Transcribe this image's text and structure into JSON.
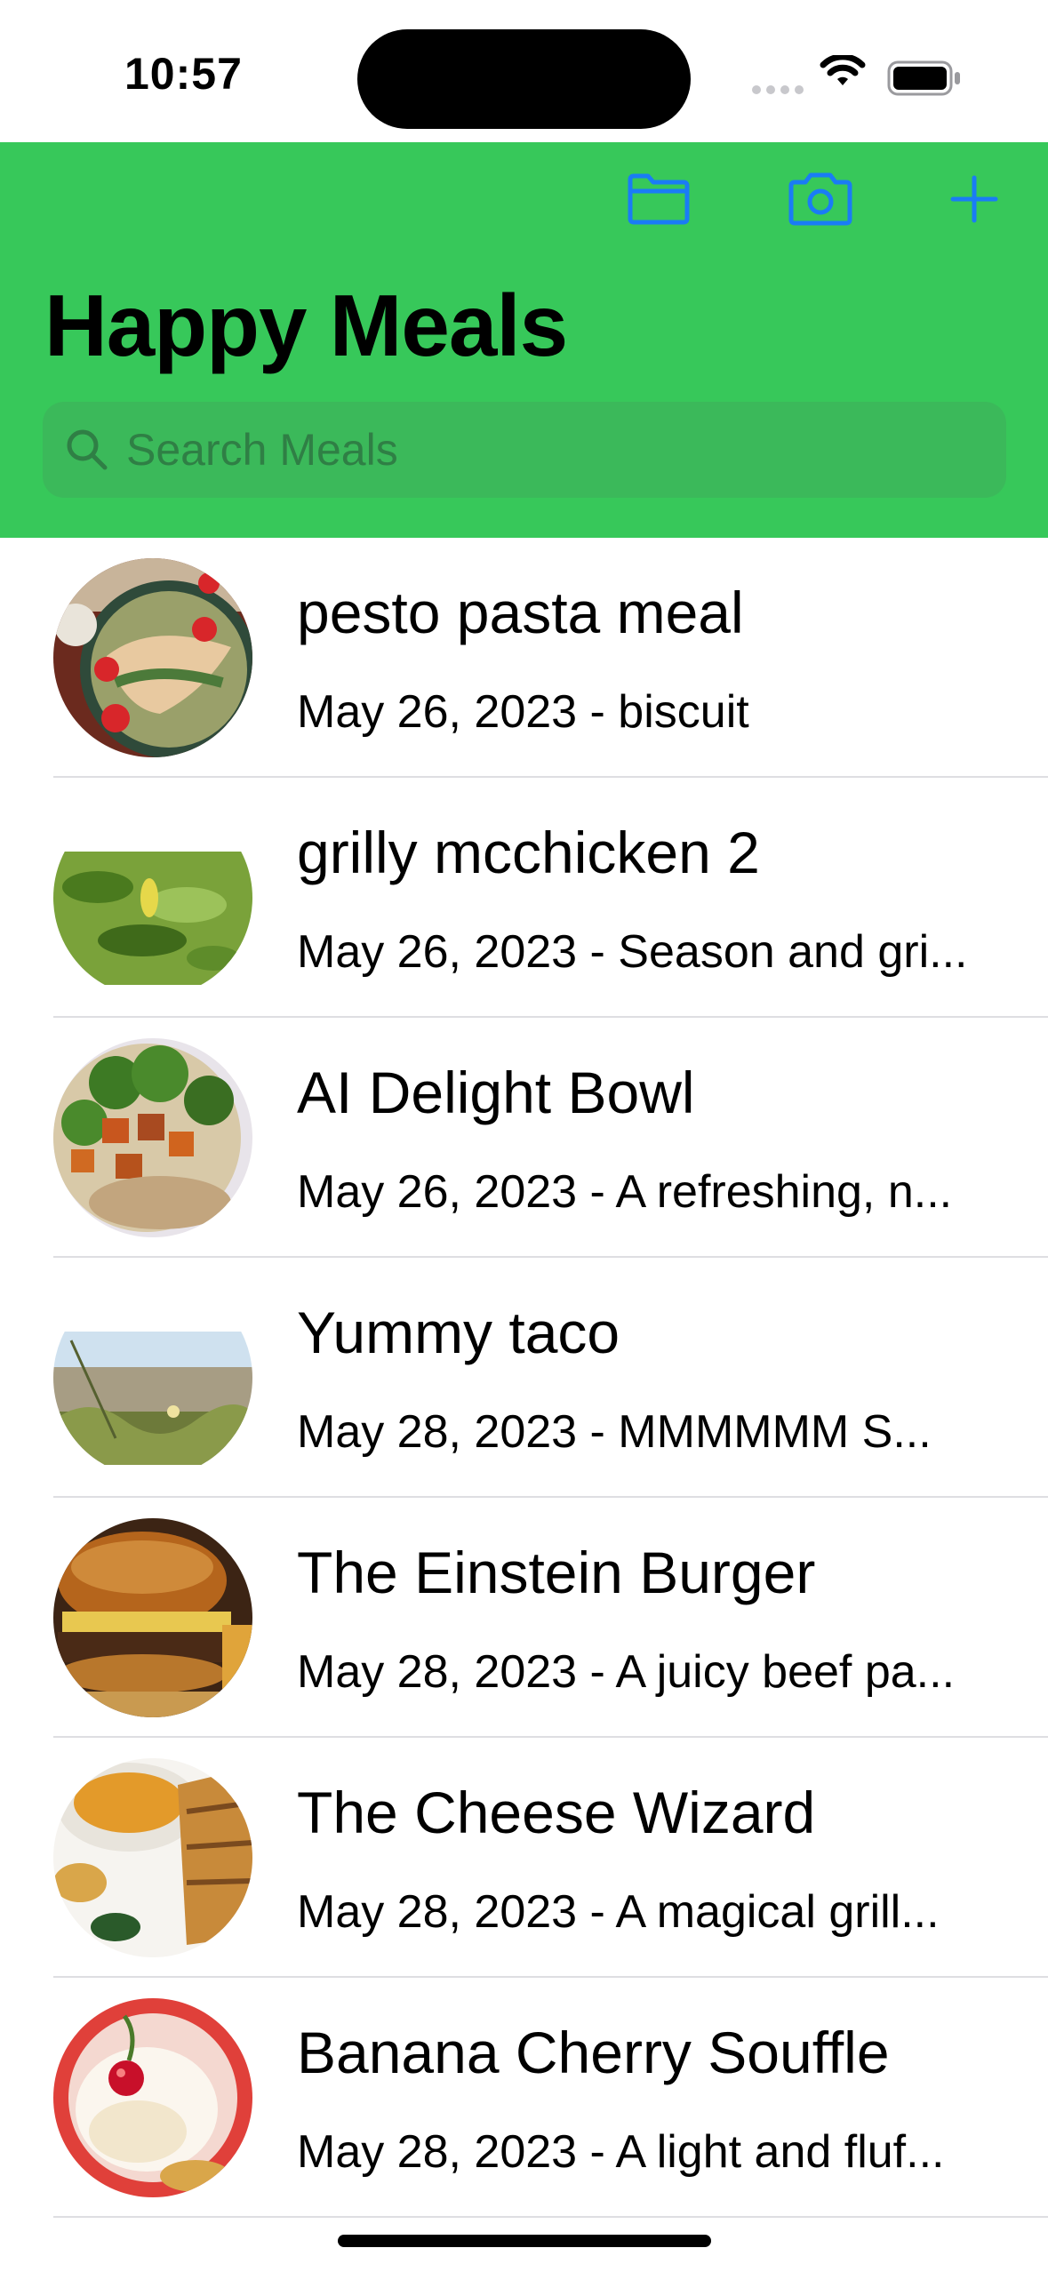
{
  "status_bar": {
    "time": "10:57"
  },
  "nav": {
    "title": "Happy Meals",
    "accent_color": "#1a7cf5",
    "background_color": "#37c85a",
    "actions": [
      {
        "icon": "folder-icon"
      },
      {
        "icon": "camera-icon"
      },
      {
        "icon": "plus-icon"
      }
    ]
  },
  "search": {
    "placeholder": "Search Meals",
    "icon": "magnifying-glass-icon"
  },
  "meals": [
    {
      "title": "pesto pasta meal",
      "subtitle": "May 26, 2023 - biscuit",
      "thumbnail": "pasta-salad-photo"
    },
    {
      "title": "grilly mcchicken 2",
      "subtitle": "May 26, 2023 - Season and gri...",
      "thumbnail": "green-leaves-photo"
    },
    {
      "title": "AI Delight Bowl",
      "subtitle": "May 26, 2023 - A refreshing, n...",
      "thumbnail": "broccoli-tofu-bowl-photo"
    },
    {
      "title": "Yummy taco",
      "subtitle": "May 28, 2023 - MMMMMM S...",
      "thumbnail": "dune-plants-photo"
    },
    {
      "title": "The Einstein Burger",
      "subtitle": "May 28, 2023 - A juicy beef pa...",
      "thumbnail": "burger-photo"
    },
    {
      "title": "The Cheese Wizard",
      "subtitle": "May 28, 2023 - A magical grill...",
      "thumbnail": "grilled-cheese-soup-photo"
    },
    {
      "title": "Banana Cherry Souffle",
      "subtitle": "May 28, 2023 - A light and fluf...",
      "thumbnail": "cherry-dessert-photo"
    }
  ]
}
